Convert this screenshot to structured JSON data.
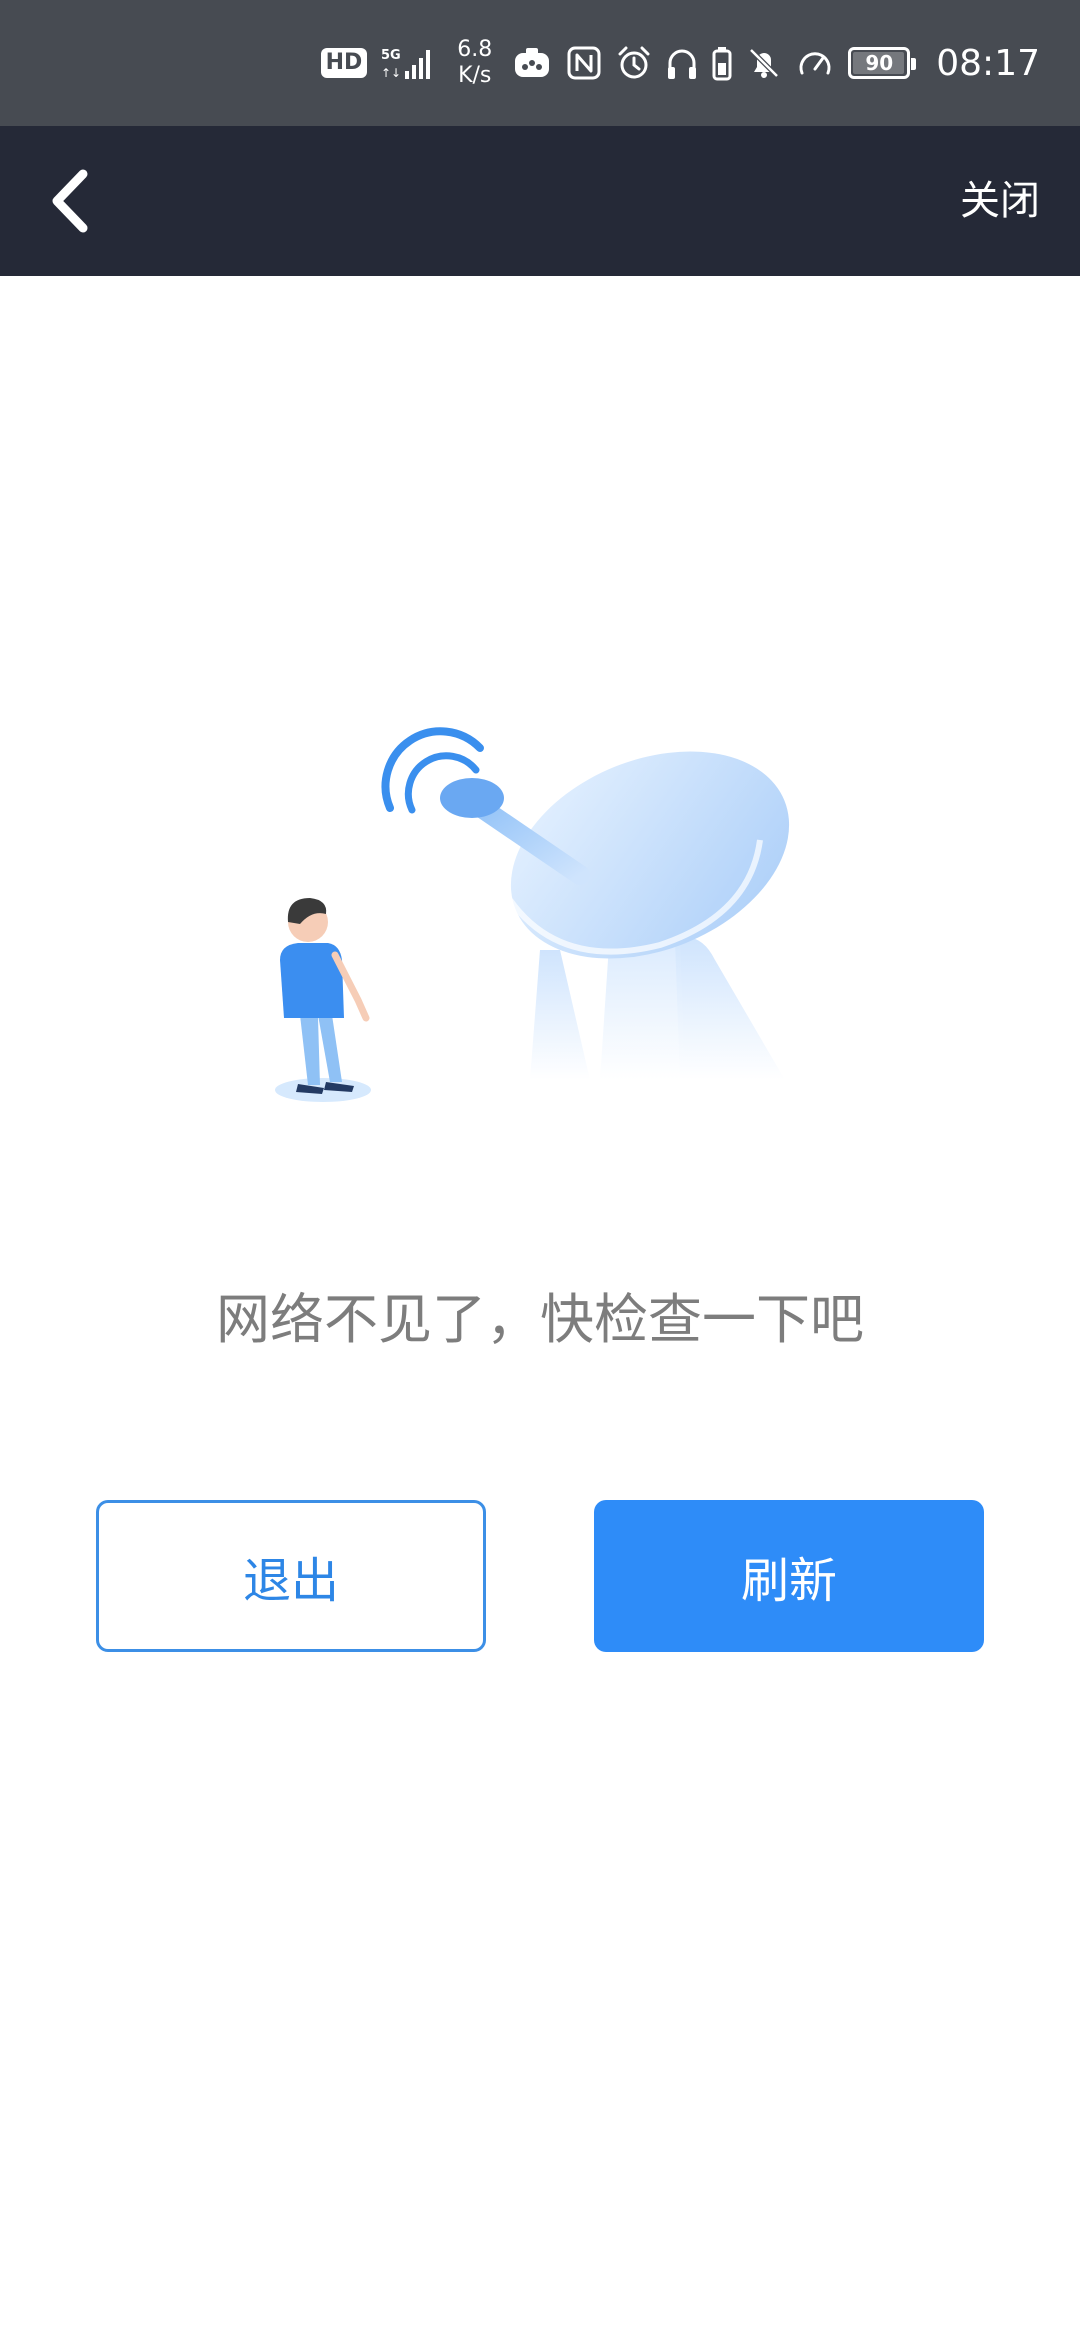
{
  "status_bar": {
    "hd_label": "HD",
    "signal_label": "5G",
    "speed_value": "6.8",
    "speed_unit": "K/s",
    "battery_level": "90",
    "time": "08:17",
    "icons": [
      "hd-icon",
      "signal-5g-icon",
      "net-speed-readout",
      "app-notification-icon",
      "nfc-icon",
      "alarm-icon",
      "headphones-icon",
      "battery-saver-icon",
      "mute-bell-icon",
      "speedometer-icon",
      "battery-icon"
    ]
  },
  "nav": {
    "back_icon": "chevron-left-icon",
    "close_label": "关闭"
  },
  "main": {
    "illustration": "person-and-satellite-dish",
    "message": "网络不见了，快检查一下吧",
    "exit_label": "退出",
    "refresh_label": "刷新"
  },
  "colors": {
    "status_bar_bg": "#474b52",
    "nav_bar_bg": "#252937",
    "accent_blue": "#2e8cf8",
    "message_gray": "#7d7d7d"
  }
}
